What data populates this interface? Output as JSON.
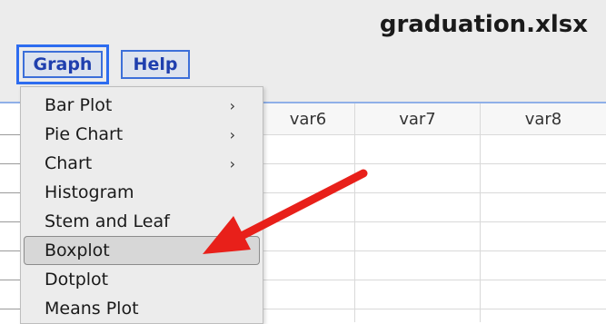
{
  "window": {
    "file_title": "graduation.xlsx"
  },
  "menubar": {
    "graph_label": "Graph",
    "help_label": "Help"
  },
  "columns": [
    {
      "label": "var6"
    },
    {
      "label": "var7"
    },
    {
      "label": "var8"
    }
  ],
  "graph_menu": {
    "items": [
      {
        "label": "Bar Plot",
        "submenu": "›"
      },
      {
        "label": "Pie Chart",
        "submenu": "›"
      },
      {
        "label": "Chart",
        "submenu": "›"
      },
      {
        "label": "Histogram"
      },
      {
        "label": "Stem and Leaf"
      },
      {
        "label": "Boxplot",
        "selected": true
      },
      {
        "label": "Dotplot"
      },
      {
        "label": "Means Plot"
      }
    ]
  },
  "annotation": {
    "arrow_color": "#e8201a"
  }
}
